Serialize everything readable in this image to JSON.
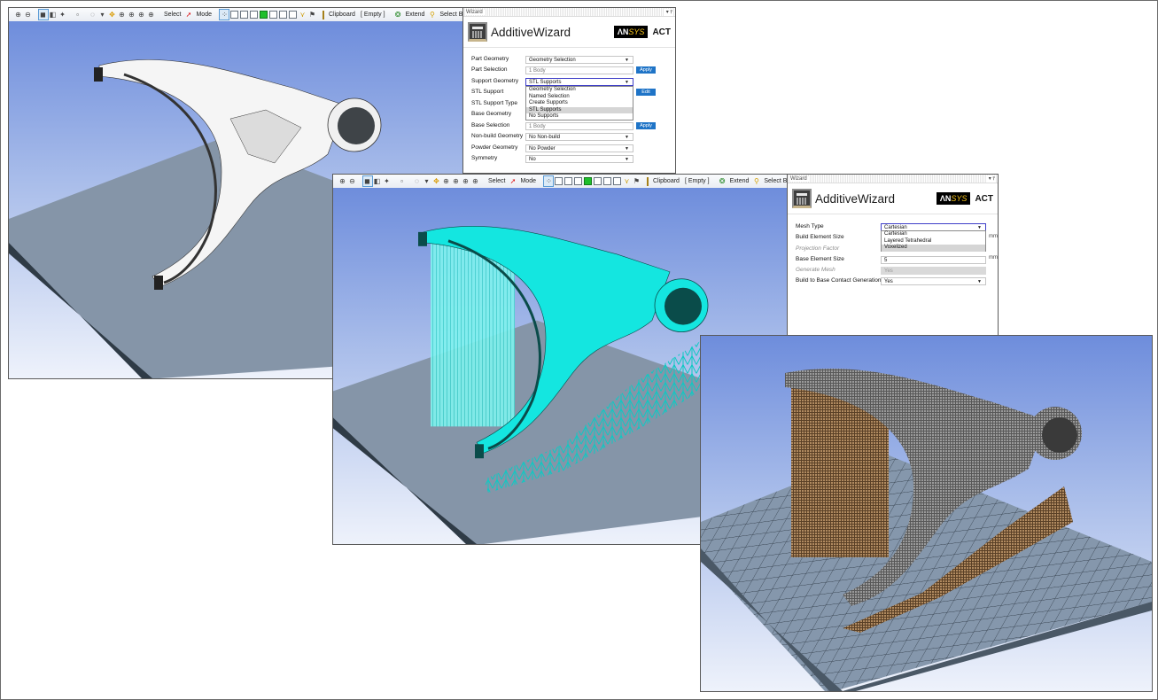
{
  "toolbar": {
    "items": [
      {
        "icon": "zoom-in-icon"
      },
      {
        "icon": "zoom-out-icon"
      },
      {
        "icon": "shaded-view-icon",
        "selected": true
      },
      {
        "icon": "wireframe-icon"
      },
      {
        "icon": "show-vertices-icon"
      },
      {
        "icon": "graphics-toggle-icon"
      },
      {
        "icon": "rotate-icon"
      },
      {
        "icon": "pan-icon"
      },
      {
        "icon": "zoom-icon"
      },
      {
        "icon": "box-zoom-icon"
      },
      {
        "icon": "zoom-fit-icon"
      },
      {
        "icon": "magnifier-icon"
      }
    ],
    "select_label": "Select",
    "mode_label": "Mode",
    "clipboard_label": "Clipboard",
    "empty_label": "[ Empty ]",
    "extend_label": "Extend",
    "select_by_label": "Select By"
  },
  "wizard1": {
    "panel_title": "Wizard",
    "name": "AdditiveWizard",
    "brand": {
      "an": "ΛN",
      "sys": "SYS",
      "product": "ACT"
    },
    "rows": [
      {
        "label": "Part Geometry",
        "value": "Geometry Selection",
        "type": "dropdown"
      },
      {
        "label": "Part Selection",
        "value": "1 Body",
        "type": "readonly",
        "button": "Apply"
      },
      {
        "label": "Support Geometry",
        "value": "STL Supports",
        "type": "dropdown-open"
      },
      {
        "label": "STL Support",
        "button": "Edit"
      },
      {
        "label": "STL Support Type"
      },
      {
        "label": "Base Geometry"
      },
      {
        "label": "Base Selection",
        "value": "1 Body",
        "type": "readonly",
        "button": "Apply"
      },
      {
        "label": "Non-build Geometry",
        "value": "No Non-build",
        "type": "dropdown"
      },
      {
        "label": "Powder Geometry",
        "value": "No Powder",
        "type": "dropdown"
      },
      {
        "label": "Symmetry",
        "value": "No",
        "type": "dropdown"
      }
    ],
    "open_dropdown_options": [
      "Geometry Selection",
      "Named Selection",
      "Create Supports",
      "STL Supports",
      "No Supports"
    ],
    "open_dropdown_highlight": "STL Supports"
  },
  "wizard2": {
    "panel_title": "Wizard",
    "name": "AdditiveWizard",
    "brand": {
      "an": "ΛN",
      "sys": "SYS",
      "product": "ACT"
    },
    "rows": [
      {
        "label": "Mesh Type",
        "value": "Cartesian",
        "type": "dropdown-open"
      },
      {
        "label": "Build Element Size",
        "unit": "mm"
      },
      {
        "label": "Projection Factor",
        "dim": true
      },
      {
        "label": "Base Element Size",
        "value": "5",
        "unit": "mm"
      },
      {
        "label": "Generate Mesh",
        "value": "Yes",
        "dim": true,
        "type": "disabled"
      },
      {
        "label": "Build to Base Contact Generation",
        "value": "Yes",
        "type": "dropdown"
      }
    ],
    "open_dropdown_options": [
      "Cartesian",
      "Layered Tetrahedral",
      "Voxelized"
    ],
    "open_dropdown_highlight": "Voxelized"
  },
  "viewports": {
    "v1": {
      "part_color": "#ffffff",
      "plate_color": "#8595a8"
    },
    "v2": {
      "part_color": "#14e6e0",
      "support_color": "#14e6e0",
      "plate_color": "#8595a8"
    },
    "v3": {
      "part_color": "#6e6e6e",
      "support_color": "#a07850",
      "plate_color": "#8597ac"
    }
  }
}
